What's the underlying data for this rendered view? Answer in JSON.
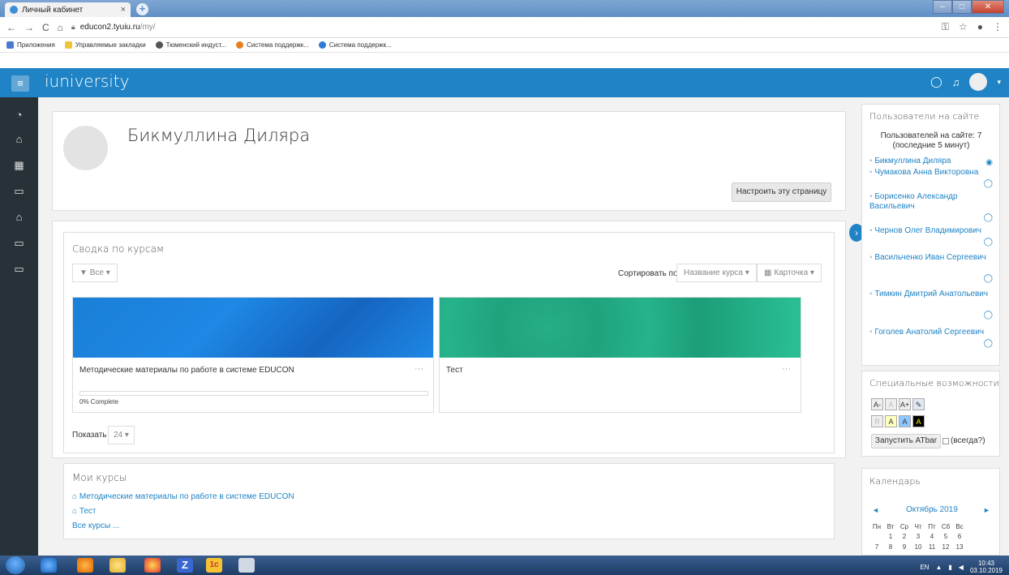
{
  "browser": {
    "tab_title": "Личный кабинет",
    "tab_close": "×",
    "new_tab": "+",
    "url_host": "educon2.tyuiu.ru",
    "url_path": "/my/",
    "bookmarks": [
      "Приложения",
      "Управляемые закладки",
      "Тюменский индуст...",
      "Система поддержк...",
      "Система поддержк..."
    ]
  },
  "navbar": {
    "brand": "iuniversity",
    "accent_color": "#1f83c5"
  },
  "profile": {
    "name": "Бикмуллина Диляра",
    "customize_button": "Настроить эту страницу"
  },
  "course_overview": {
    "title": "Сводка по курсам",
    "filter": "Все",
    "sort_label": "Сортировать по",
    "sort_value": "Название курса",
    "view_value": "Карточка",
    "courses": [
      {
        "title": "Методические материалы по работе в системе EDUCON",
        "progress_label": "0% Complete",
        "progress": 0
      },
      {
        "title": "Тест"
      }
    ],
    "show_label": "Показать",
    "show_value": "24"
  },
  "my_courses": {
    "title": "Мои курсы",
    "items": [
      "Методические материалы по работе в системе EDUCON",
      "Тест"
    ],
    "all_courses": "Все курсы ..."
  },
  "online_users": {
    "title": "Пользователи на сайте",
    "summary": "Пользователей на сайте: 7",
    "period": "(последние 5 минут)",
    "users": [
      "Бикмуллина Диляра",
      "Чумакова Анна Викторовна",
      "Борисенко Александр Васильевич",
      "Чернов Олег Владимирович",
      "Васильченко Иван Сергеевич",
      "Тимкин Дмитрий Анатольевич",
      "Гоголев Анатолий Сергеевич"
    ]
  },
  "accessibility": {
    "title": "Специальные возможности",
    "buttons_row1": [
      "A-",
      "A",
      "A+"
    ],
    "buttons_row2": [
      "R",
      "A",
      "A",
      "A"
    ],
    "atbar_button": "Запустить ATbar",
    "always_label": "(всегда?)"
  },
  "calendar": {
    "title": "Календарь",
    "month": "Октябрь 2019",
    "weekdays": [
      "Пн",
      "Вт",
      "Ср",
      "Чт",
      "Пт",
      "Сб",
      "Вс"
    ],
    "week1": [
      "1",
      "2",
      "3",
      "4",
      "5",
      "6"
    ],
    "week2": [
      "7",
      "8",
      "9",
      "10",
      "11",
      "12",
      "13"
    ]
  },
  "taskbar": {
    "lang": "EN",
    "time": "10:43",
    "date": "03.10.2019"
  }
}
